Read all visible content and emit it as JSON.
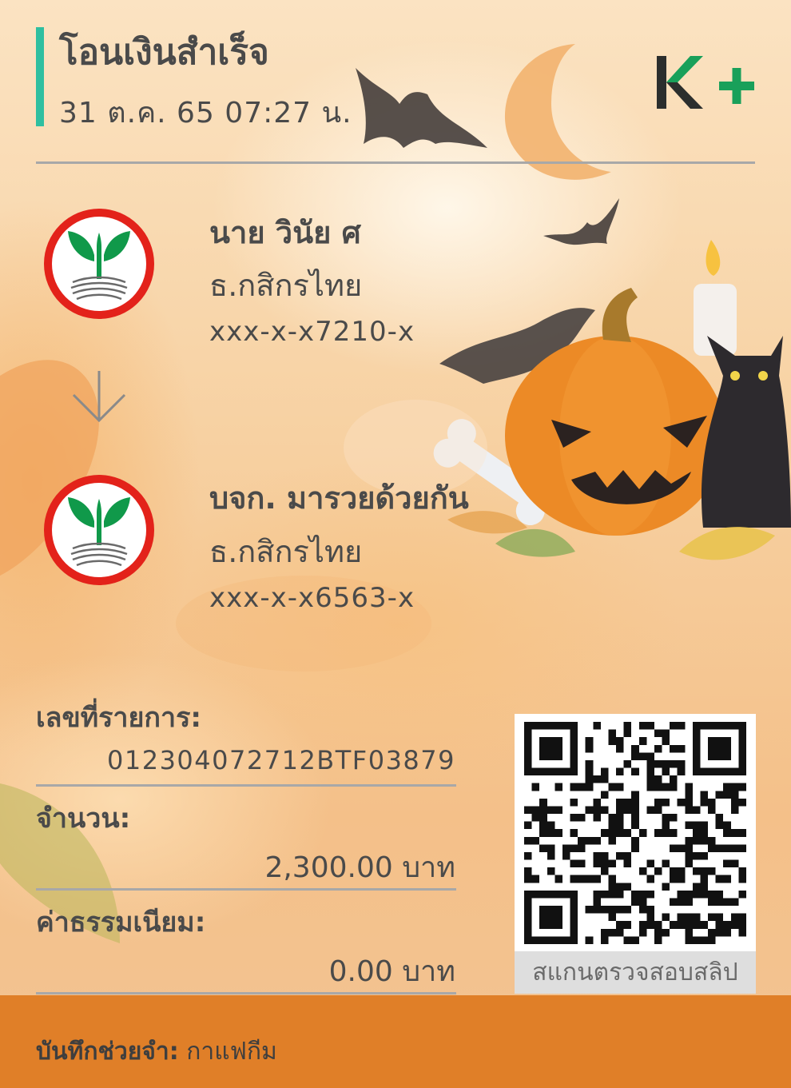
{
  "header": {
    "title": "โอนเงินสำเร็จ",
    "datetime": "31 ต.ค. 65  07:27 น.",
    "logo_text": "K+",
    "accent_color": "#2fbfa0"
  },
  "sender": {
    "name": "นาย วินัย ศ",
    "bank": "ธ.กสิกรไทย",
    "account": "xxx-x-x7210-x",
    "bank_icon": "kasikorn-bank-icon"
  },
  "transfer_arrow_icon": "arrow-down-icon",
  "receiver": {
    "name": "บจก. มารวยด้วยกัน",
    "bank": "ธ.กสิกรไทย",
    "account": "xxx-x-x6563-x",
    "bank_icon": "kasikorn-bank-icon"
  },
  "details": {
    "txn_label": "เลขที่รายการ:",
    "txn_value": "012304072712BTF03879",
    "amount_label": "จำนวน:",
    "amount_value": "2,300.00 บาท",
    "fee_label": "ค่าธรรมเนียม:",
    "fee_value": "0.00 บาท"
  },
  "qr": {
    "caption": "สแกนตรวจสอบสลิป"
  },
  "footer": {
    "memo_label": "บันทึกช่วยจำ:",
    "memo_value": "กาแฟกีม",
    "color": "#e07f28"
  }
}
